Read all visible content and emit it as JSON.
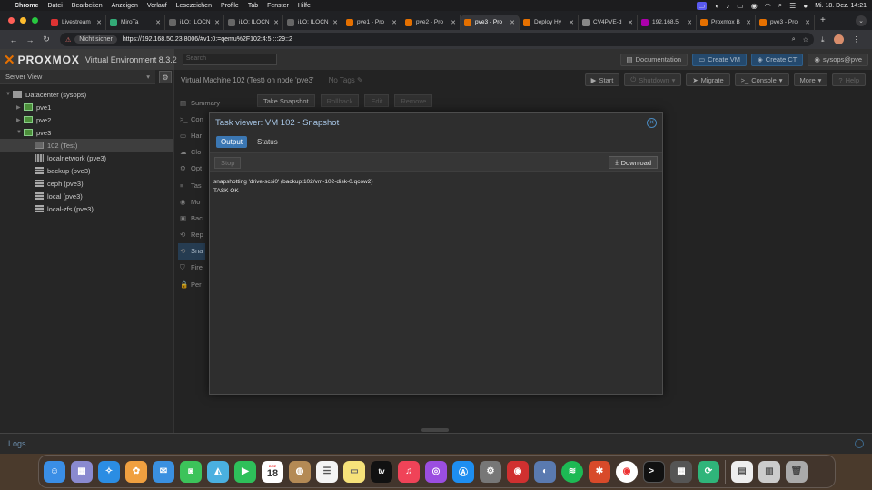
{
  "menubar": {
    "app": "Chrome",
    "items": [
      "Datei",
      "Bearbeiten",
      "Anzeigen",
      "Verlauf",
      "Lesezeichen",
      "Profile",
      "Tab",
      "Fenster",
      "Hilfe"
    ],
    "datetime": "Mi. 18. Dez.  14:21"
  },
  "tabs": [
    {
      "title": "Livestream",
      "color": "#d33"
    },
    {
      "title": "MiroTa",
      "color": "#3a7"
    },
    {
      "title": "iLO: ILOCN",
      "color": "#666"
    },
    {
      "title": "iLO: ILOCN",
      "color": "#666"
    },
    {
      "title": "iLO: ILOCN",
      "color": "#666"
    },
    {
      "title": "pve1 - Pro",
      "color": "#e57000"
    },
    {
      "title": "pve2 - Pro",
      "color": "#e57000"
    },
    {
      "title": "pve3 - Pro",
      "color": "#e57000",
      "active": true
    },
    {
      "title": "Deploy Hy",
      "color": "#e57000"
    },
    {
      "title": "CV4PVE-d",
      "color": "#888"
    },
    {
      "title": "192.168.5",
      "color": "#a0a"
    },
    {
      "title": "Proxmox B",
      "color": "#e57000"
    },
    {
      "title": "pve3 - Pro",
      "color": "#e57000"
    }
  ],
  "address": {
    "security": "Nicht sicher",
    "url": "https://192.168.50.23:8006/#v1:0:=qemu%2F102:4:5::::29::2"
  },
  "pve": {
    "brand": "PROXMOX",
    "subtitle": "Virtual Environment 8.3.2",
    "search_placeholder": "Search",
    "header_buttons": {
      "documentation": "Documentation",
      "create_vm": "Create VM",
      "create_ct": "Create CT",
      "user": "sysops@pve"
    },
    "view": "Server View",
    "tree": [
      {
        "label": "Datacenter (sysops)",
        "type": "dc",
        "indent": 0
      },
      {
        "label": "pve1",
        "type": "node",
        "indent": 1
      },
      {
        "label": "pve2",
        "type": "node",
        "indent": 1
      },
      {
        "label": "pve3",
        "type": "node",
        "indent": 1
      },
      {
        "label": "102 (Test)",
        "type": "vm",
        "indent": 2,
        "selected": true
      },
      {
        "label": "localnetwork (pve3)",
        "type": "net",
        "indent": 2
      },
      {
        "label": "backup (pve3)",
        "type": "store",
        "indent": 2
      },
      {
        "label": "ceph (pve3)",
        "type": "store",
        "indent": 2
      },
      {
        "label": "local (pve3)",
        "type": "store",
        "indent": 2
      },
      {
        "label": "local-zfs (pve3)",
        "type": "store",
        "indent": 2
      }
    ],
    "vm_title": "Virtual Machine 102 (Test) on node 'pve3'",
    "no_tags": "No Tags",
    "vm_buttons": {
      "start": "Start",
      "shutdown": "Shutdown",
      "migrate": "Migrate",
      "console": "Console",
      "more": "More",
      "help": "Help"
    },
    "vm_menu": [
      "Summary",
      "Con",
      "Har",
      "Clo",
      "Opt",
      "Tas",
      "Mo",
      "Bac",
      "Rep",
      "Sna",
      "Fire",
      "Per"
    ],
    "vm_menu_icons": [
      "▤",
      ">_",
      "▭",
      "☁",
      "⚙",
      "≡",
      "◉",
      "▣",
      "⟲",
      "⟲",
      "⛉",
      "🔒"
    ],
    "snapshot_toolbar": [
      "Take Snapshot",
      "Rollback",
      "Edit",
      "Remove"
    ],
    "logs_label": "Logs"
  },
  "task_viewer": {
    "title": "Task viewer: VM 102 - Snapshot",
    "tabs": [
      "Output",
      "Status"
    ],
    "stop": "Stop",
    "download": "Download",
    "output_lines": [
      "snapshotting 'drive-scsi0' (backup:102/vm-102-disk-0.qcow2)",
      "TASK OK"
    ]
  },
  "dock": {
    "calendar_month": "DEZ",
    "calendar_day": "18",
    "tv_label": "tv"
  }
}
